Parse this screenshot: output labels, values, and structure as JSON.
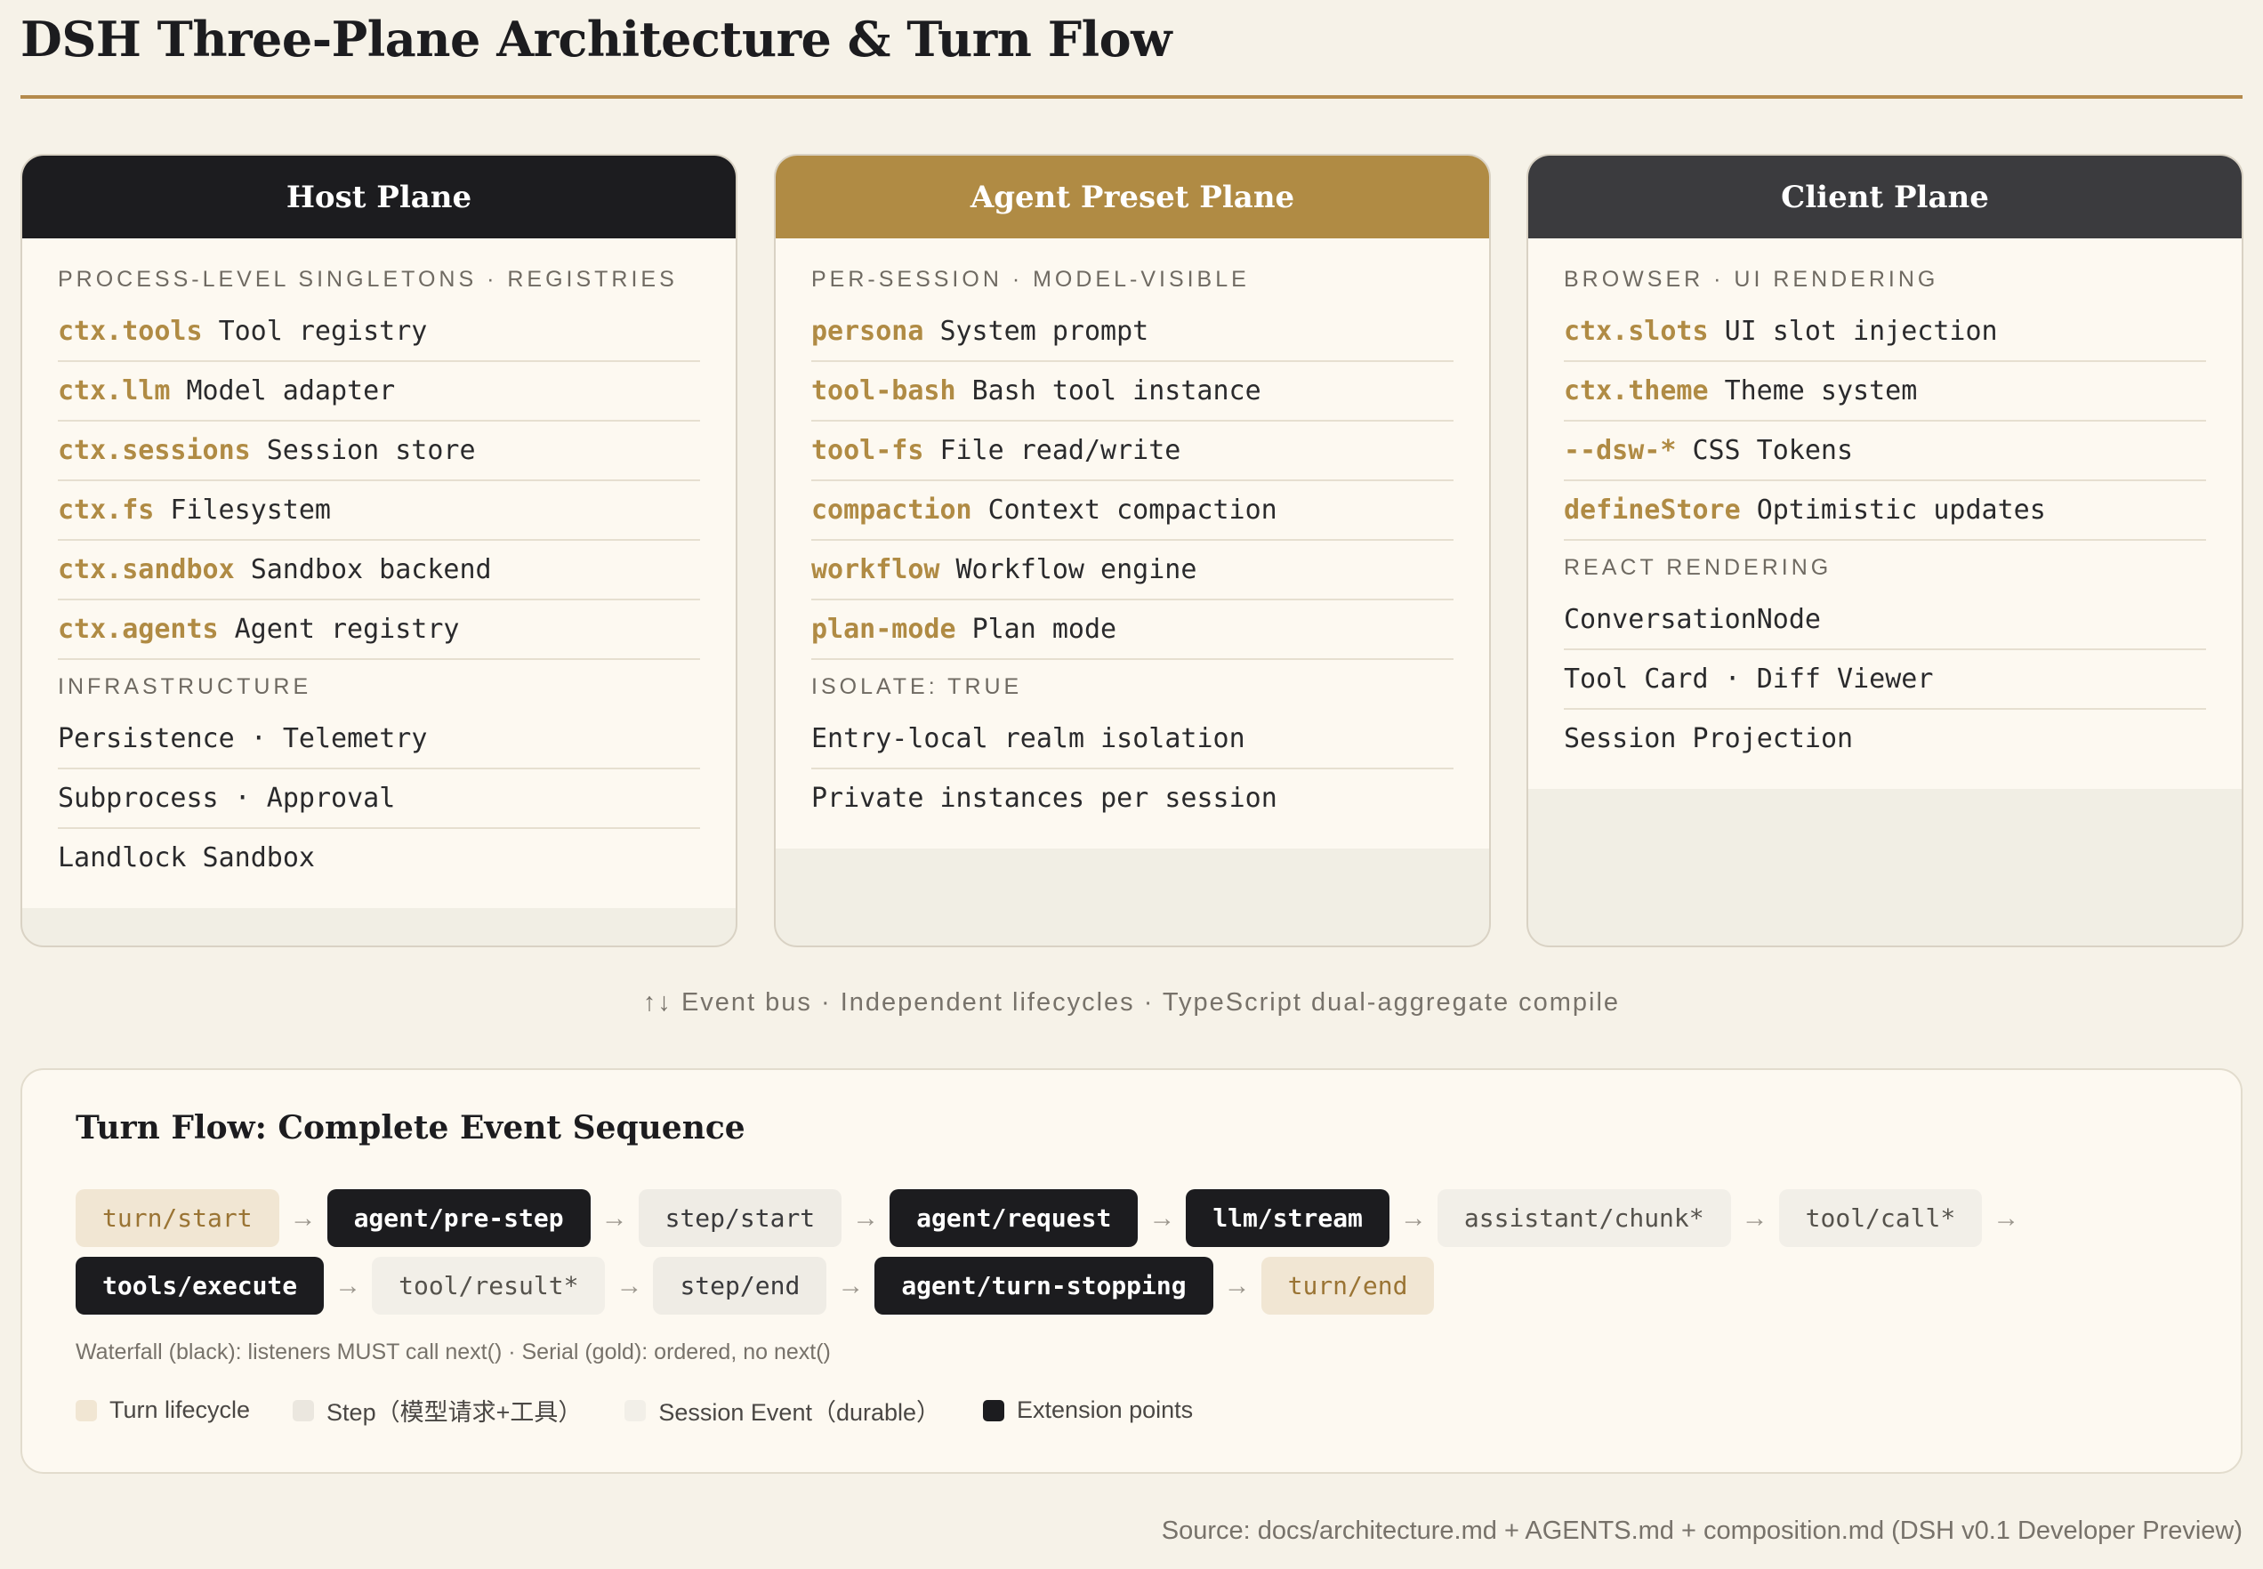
{
  "title": "DSH Three-Plane Architecture & Turn Flow",
  "planes": {
    "host": {
      "header": "Host Plane",
      "sections": [
        {
          "label": "PROCESS-LEVEL SINGLETONS · REGISTRIES",
          "items": [
            {
              "key": "ctx.tools",
              "desc": "Tool registry"
            },
            {
              "key": "ctx.llm",
              "desc": "Model adapter"
            },
            {
              "key": "ctx.sessions",
              "desc": "Session store"
            },
            {
              "key": "ctx.fs",
              "desc": "Filesystem"
            },
            {
              "key": "ctx.sandbox",
              "desc": "Sandbox backend"
            },
            {
              "key": "ctx.agents",
              "desc": "Agent registry"
            }
          ]
        },
        {
          "label": "INFRASTRUCTURE",
          "items": [
            {
              "desc": "Persistence · Telemetry"
            },
            {
              "desc": "Subprocess · Approval"
            },
            {
              "desc": "Landlock Sandbox"
            }
          ]
        }
      ]
    },
    "agent": {
      "header": "Agent Preset Plane",
      "sections": [
        {
          "label": "PER-SESSION · MODEL-VISIBLE",
          "items": [
            {
              "key": "persona",
              "desc": "System prompt"
            },
            {
              "key": "tool-bash",
              "desc": "Bash tool instance"
            },
            {
              "key": "tool-fs",
              "desc": "File read/write"
            },
            {
              "key": "compaction",
              "desc": "Context compaction"
            },
            {
              "key": "workflow",
              "desc": "Workflow engine"
            },
            {
              "key": "plan-mode",
              "desc": "Plan mode"
            }
          ]
        },
        {
          "label": "ISOLATE: TRUE",
          "items": [
            {
              "desc": "Entry-local realm isolation"
            },
            {
              "desc": "Private instances per session"
            }
          ]
        }
      ]
    },
    "client": {
      "header": "Client Plane",
      "sections": [
        {
          "label": "BROWSER · UI RENDERING",
          "items": [
            {
              "key": "ctx.slots",
              "desc": "UI slot injection"
            },
            {
              "key": "ctx.theme",
              "desc": "Theme system"
            },
            {
              "key": "--dsw-*",
              "desc": "CSS Tokens"
            },
            {
              "key": "defineStore",
              "desc": "Optimistic updates"
            }
          ]
        },
        {
          "label": "REACT RENDERING",
          "items": [
            {
              "desc": "ConversationNode"
            },
            {
              "desc": "Tool Card · Diff Viewer"
            },
            {
              "desc": "Session Projection"
            }
          ]
        }
      ]
    }
  },
  "connector": "↑↓ Event bus · Independent lifecycles · TypeScript dual-aggregate compile",
  "turn_flow": {
    "title": "Turn Flow: Complete Event Sequence",
    "arrow": "→",
    "rows": [
      [
        {
          "label": "turn/start",
          "kind": "turn"
        },
        {
          "label": "agent/pre-step",
          "kind": "ext"
        },
        {
          "label": "step/start",
          "kind": "step"
        },
        {
          "label": "agent/request",
          "kind": "ext"
        },
        {
          "label": "llm/stream",
          "kind": "ext"
        },
        {
          "label": "assistant/chunk*",
          "kind": "session"
        },
        {
          "label": "tool/call*",
          "kind": "session"
        }
      ],
      [
        {
          "label": "tools/execute",
          "kind": "ext"
        },
        {
          "label": "tool/result*",
          "kind": "session"
        },
        {
          "label": "step/end",
          "kind": "step"
        },
        {
          "label": "agent/turn-stopping",
          "kind": "ext"
        },
        {
          "label": "turn/end",
          "kind": "turn"
        }
      ]
    ],
    "note": "Waterfall (black): listeners MUST call next() · Serial (gold): ordered, no next()",
    "legend": [
      {
        "kind": "turn",
        "label": "Turn lifecycle"
      },
      {
        "kind": "step",
        "label": "Step（模型请求+工具）"
      },
      {
        "kind": "session",
        "label": "Session Event（durable）"
      },
      {
        "kind": "ext",
        "label": "Extension points"
      }
    ]
  },
  "source": "Source: docs/architecture.md + AGENTS.md + composition.md (DSH v0.1 Developer Preview)"
}
